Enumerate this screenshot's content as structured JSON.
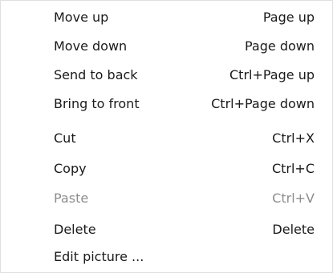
{
  "menu": {
    "items": [
      {
        "label": "Move up",
        "shortcut": "Page up",
        "enabled": true
      },
      {
        "label": "Move down",
        "shortcut": "Page down",
        "enabled": true
      },
      {
        "label": "Send to back",
        "shortcut": "Ctrl+Page up",
        "enabled": true
      },
      {
        "label": "Bring to front",
        "shortcut": "Ctrl+Page down",
        "enabled": true
      },
      {
        "label": "Cut",
        "shortcut": "Ctrl+X",
        "enabled": true
      },
      {
        "label": "Copy",
        "shortcut": "Ctrl+C",
        "enabled": true
      },
      {
        "label": "Paste",
        "shortcut": "Ctrl+V",
        "enabled": false
      },
      {
        "label": "Delete",
        "shortcut": "Delete",
        "enabled": true
      },
      {
        "label": "Edit picture ...",
        "shortcut": "",
        "enabled": true
      }
    ]
  }
}
